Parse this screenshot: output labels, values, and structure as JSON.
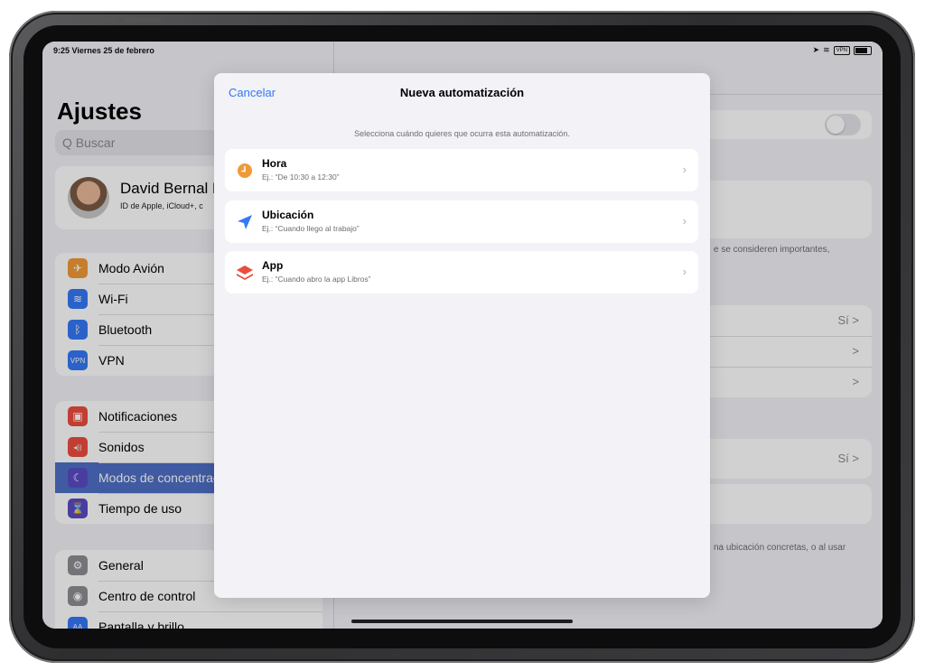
{
  "status": {
    "time_date": "9:25  Viernes 25 de febrero",
    "vpn": "VPN"
  },
  "sidebar": {
    "title": "Ajustes",
    "search_placeholder": "Q Buscar",
    "profile": {
      "name": "David Bernal R",
      "subtitle": "ID de Apple, iCloud+, c"
    },
    "group1": [
      {
        "label": "Modo Avión",
        "icon": "airplane-icon",
        "color": "#f09a37",
        "glyph": "✈"
      },
      {
        "label": "Wi-Fi",
        "icon": "wifi-icon",
        "color": "#3478f6",
        "glyph": "≋"
      },
      {
        "label": "Bluetooth",
        "icon": "bluetooth-icon",
        "color": "#3478f6",
        "glyph": "ᛒ"
      },
      {
        "label": "VPN",
        "icon": "vpn-icon",
        "color": "#3478f6",
        "glyph": "VPN"
      }
    ],
    "group2": [
      {
        "label": "Notificaciones",
        "icon": "notifications-icon",
        "color": "#eb4d3d",
        "glyph": "▣"
      },
      {
        "label": "Sonidos",
        "icon": "sounds-icon",
        "color": "#eb4d3d",
        "glyph": "◂))"
      },
      {
        "label": "Modos de concentrac",
        "icon": "moon-icon",
        "color": "#5b4bc4",
        "glyph": "☾"
      },
      {
        "label": "Tiempo de uso",
        "icon": "hourglass-icon",
        "color": "#5b4bc4",
        "glyph": "⌛"
      }
    ],
    "group3": [
      {
        "label": "General",
        "icon": "gear-icon",
        "color": "#8e8e93",
        "glyph": "⚙"
      },
      {
        "label": "Centro de control",
        "icon": "control-center-icon",
        "color": "#8e8e93",
        "glyph": "◉"
      },
      {
        "label": "Pantalla y brillo",
        "icon": "display-icon",
        "color": "#3478f6",
        "glyph": "AA"
      }
    ]
  },
  "detail": {
    "note1": "e se consideren importantes,",
    "row_si_1": "Sí >",
    "row_chevron": ">",
    "row_si_2": "Sí >",
    "note2": "na ubicación concretas, o al usar"
  },
  "modal": {
    "cancel_label": "Cancelar",
    "title": "Nueva automatización",
    "subtitle": "Selecciona cuándo quieres que ocurra esta automatización.",
    "items": [
      {
        "name": "Hora",
        "desc": "Ej.: “De 10:30 a 12:30”",
        "icon": "clock-icon",
        "color": "#f09a37"
      },
      {
        "name": "Ubicación",
        "desc": "Ej.: “Cuando llego al trabajo”",
        "icon": "location-arrow-icon",
        "color": "#3478f6"
      },
      {
        "name": "App",
        "desc": "Ej.: “Cuando abro la app Libros”",
        "icon": "app-layers-icon",
        "color": "#eb4d3d"
      }
    ]
  }
}
